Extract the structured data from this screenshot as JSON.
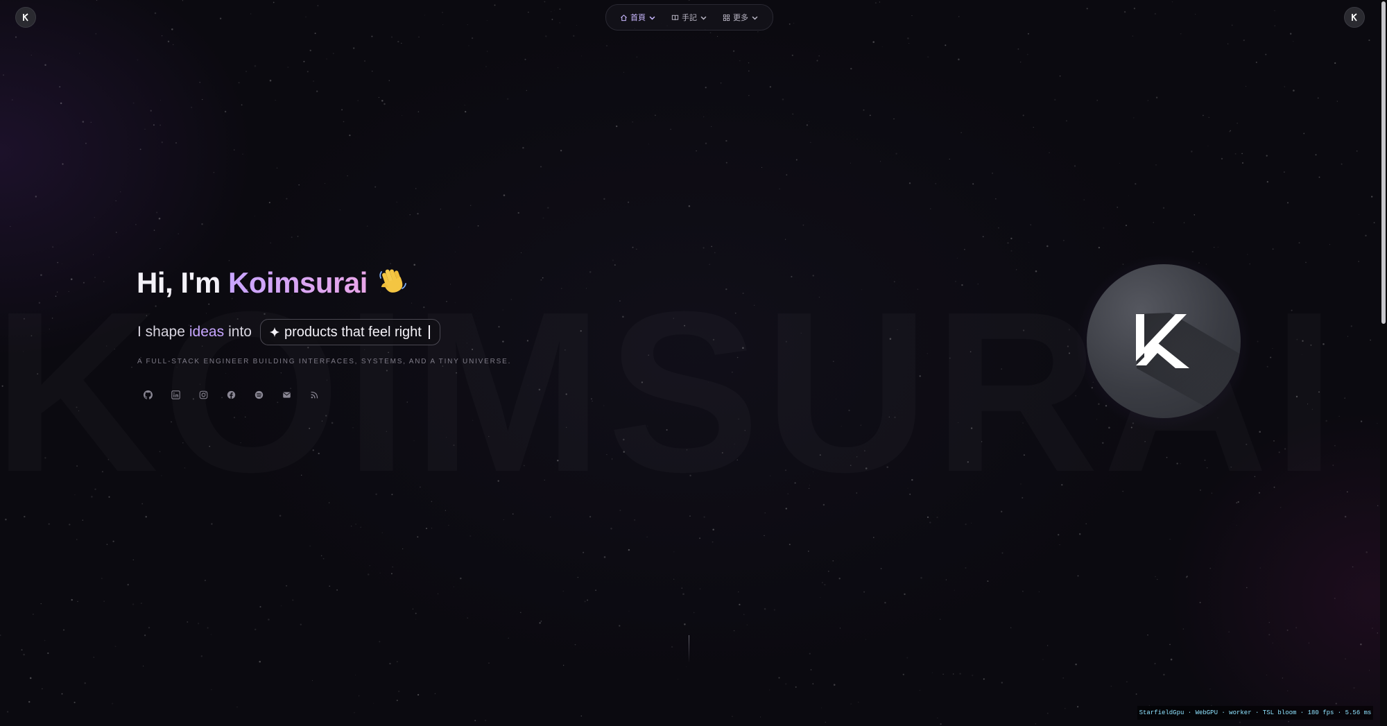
{
  "nav": {
    "items": [
      {
        "label": "首頁",
        "icon": "home-icon",
        "active": true
      },
      {
        "label": "手記",
        "icon": "book-icon",
        "active": false
      },
      {
        "label": "更多",
        "icon": "grid-icon",
        "active": false
      }
    ]
  },
  "watermark": "KOIMSURAI",
  "hero": {
    "greeting": "Hi, I'm ",
    "name": "Koimsurai",
    "tagline_prefix": "I shape",
    "tagline_highlight": "ideas",
    "tagline_into": "into",
    "tagline_pill": "products that feel right",
    "subtitle": "A FULL-STACK ENGINEER BUILDING INTERFACES, SYSTEMS, AND A TINY UNIVERSE."
  },
  "socials": [
    {
      "icon": "github-icon"
    },
    {
      "icon": "linkedin-icon"
    },
    {
      "icon": "instagram-icon"
    },
    {
      "icon": "facebook-icon"
    },
    {
      "icon": "spotify-icon"
    },
    {
      "icon": "mail-icon"
    },
    {
      "icon": "rss-icon"
    }
  ],
  "status_bar": "StarfieldGpu · WebGPU · worker · TSL bloom · 180 fps · 5.56 ms",
  "colors": {
    "background": "#0b0a10",
    "accent": "#c8a5ff",
    "status_text": "#8fe3ff"
  }
}
